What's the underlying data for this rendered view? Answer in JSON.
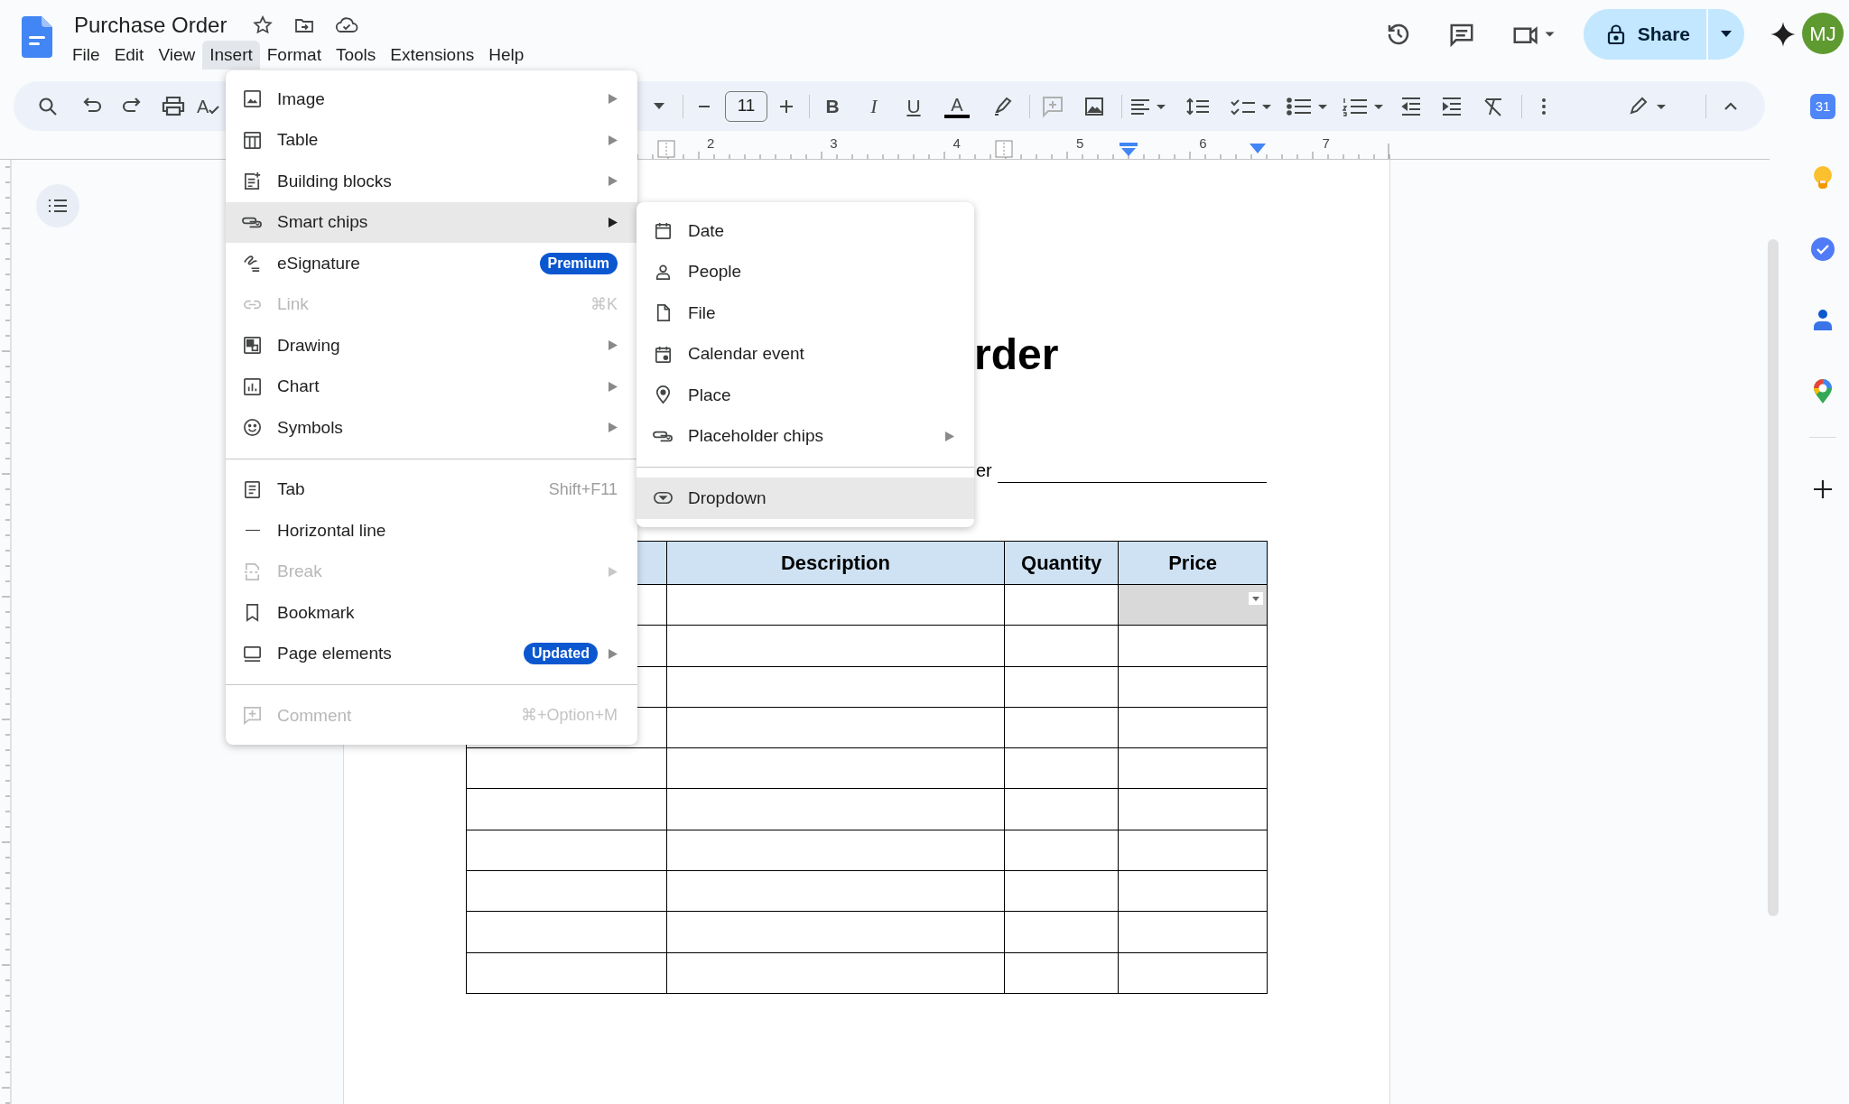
{
  "document": {
    "title": "Purchase Order"
  },
  "menu_bar": [
    {
      "label": "File",
      "selected": false
    },
    {
      "label": "Edit",
      "selected": false
    },
    {
      "label": "View",
      "selected": false
    },
    {
      "label": "Insert",
      "selected": true
    },
    {
      "label": "Format",
      "selected": false
    },
    {
      "label": "Tools",
      "selected": false
    },
    {
      "label": "Extensions",
      "selected": false
    },
    {
      "label": "Help",
      "selected": false
    }
  ],
  "share": {
    "label": "Share"
  },
  "account": {
    "initials": "MJ"
  },
  "toolbar": {
    "spellcheck_glyph": "A",
    "font_size": "11",
    "bold_glyph": "B",
    "italic_glyph": "I",
    "underline_glyph": "U",
    "text_color_glyph": "A"
  },
  "ruler": {
    "numbers": [
      "2",
      "3",
      "4",
      "5",
      "6",
      "7"
    ]
  },
  "side_panel": {
    "calendar_day": "31"
  },
  "page": {
    "heading": "rder",
    "field_label": "er",
    "table": {
      "columns": [
        "Description",
        "Quantity",
        "Price"
      ],
      "rows": [
        {
          "price_dropdown": true
        },
        {
          "price_dropdown": false
        },
        {
          "price_dropdown": false
        },
        {
          "price_dropdown": false
        },
        {
          "price_dropdown": false
        },
        {
          "price_dropdown": false
        },
        {
          "price_dropdown": false
        },
        {
          "price_dropdown": false
        },
        {
          "price_dropdown": false
        },
        {
          "price_dropdown": false
        }
      ]
    }
  },
  "insert_menu": {
    "groups": [
      {
        "items": [
          {
            "label": "Image",
            "selected": false,
            "disabled": false,
            "has_submenu": true
          },
          {
            "label": "Table",
            "selected": false,
            "disabled": false,
            "has_submenu": true
          },
          {
            "label": "Building blocks",
            "selected": false,
            "disabled": false,
            "has_submenu": true
          },
          {
            "label": "Smart chips",
            "selected": true,
            "disabled": false,
            "has_submenu": true
          },
          {
            "label": "eSignature",
            "selected": false,
            "disabled": false,
            "has_submenu": false,
            "badge": "Premium"
          },
          {
            "label": "Link",
            "selected": false,
            "disabled": true,
            "has_submenu": false,
            "shortcut": "⌘K"
          },
          {
            "label": "Drawing",
            "selected": false,
            "disabled": false,
            "has_submenu": true
          },
          {
            "label": "Chart",
            "selected": false,
            "disabled": false,
            "has_submenu": true
          },
          {
            "label": "Symbols",
            "selected": false,
            "disabled": false,
            "has_submenu": true
          }
        ]
      },
      {
        "items": [
          {
            "label": "Tab",
            "selected": false,
            "disabled": false,
            "has_submenu": false,
            "shortcut": "Shift+F11"
          },
          {
            "label": "Horizontal line",
            "selected": false,
            "disabled": false,
            "has_submenu": false
          },
          {
            "label": "Break",
            "selected": false,
            "disabled": true,
            "has_submenu": true
          },
          {
            "label": "Bookmark",
            "selected": false,
            "disabled": false,
            "has_submenu": false
          },
          {
            "label": "Page elements",
            "selected": false,
            "disabled": false,
            "has_submenu": true,
            "badge": "Updated"
          }
        ]
      },
      {
        "items": [
          {
            "label": "Comment",
            "selected": false,
            "disabled": true,
            "has_submenu": false,
            "shortcut": "⌘+Option+M"
          }
        ]
      }
    ]
  },
  "smart_chips_menu": {
    "groups": [
      {
        "items": [
          {
            "label": "Date",
            "selected": false,
            "has_submenu": false
          },
          {
            "label": "People",
            "selected": false,
            "has_submenu": false
          },
          {
            "label": "File",
            "selected": false,
            "has_submenu": false
          },
          {
            "label": "Calendar event",
            "selected": false,
            "has_submenu": false
          },
          {
            "label": "Place",
            "selected": false,
            "has_submenu": false
          },
          {
            "label": "Placeholder chips",
            "selected": false,
            "has_submenu": true
          }
        ]
      },
      {
        "items": [
          {
            "label": "Dropdown",
            "selected": true,
            "has_submenu": false
          }
        ]
      }
    ]
  }
}
